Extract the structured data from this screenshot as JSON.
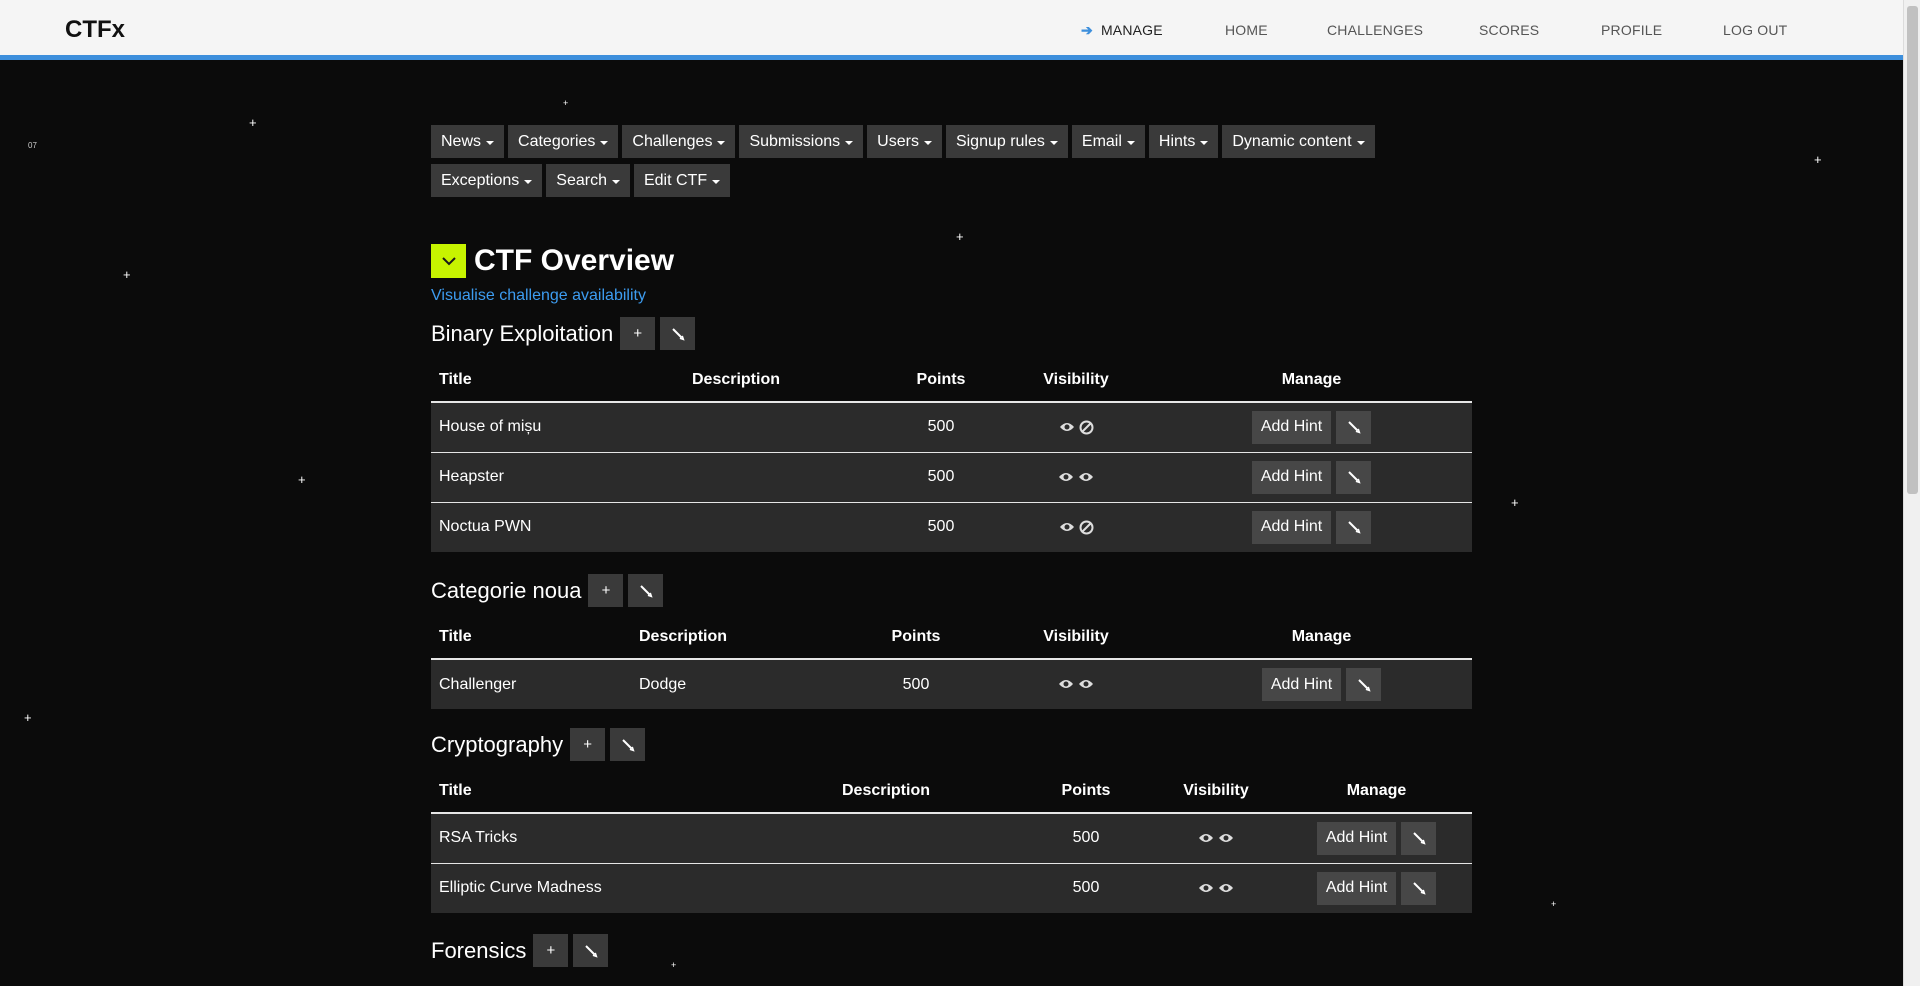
{
  "brand": "CTFx",
  "nav": {
    "manage": "MANAGE",
    "home": "HOME",
    "challenges": "CHALLENGES",
    "scores": "SCORES",
    "profile": "PROFILE",
    "logout": "LOG OUT"
  },
  "menu": {
    "row1": [
      "News",
      "Categories",
      "Challenges",
      "Submissions",
      "Users",
      "Signup rules",
      "Email",
      "Hints",
      "Dynamic content"
    ],
    "row2": [
      "Exceptions",
      "Search",
      "Edit CTF"
    ]
  },
  "star_label": "07",
  "overview": {
    "title": "CTF Overview",
    "visualise_link": "Visualise challenge availability"
  },
  "columns": {
    "title": "Title",
    "description": "Description",
    "points": "Points",
    "visibility": "Visibility",
    "manage": "Manage"
  },
  "add_hint_label": "Add Hint",
  "add_symbol": "+",
  "categories": [
    {
      "name": "Binary Exploitation",
      "challenges": [
        {
          "title": "House of mișu",
          "description": "",
          "points": "500",
          "visibility": [
            "eye-icon",
            "banned-icon"
          ]
        },
        {
          "title": "Heapster",
          "description": "",
          "points": "500",
          "visibility": [
            "eye-icon",
            "eye-icon"
          ]
        },
        {
          "title": "Noctua PWN",
          "description": "",
          "points": "500",
          "visibility": [
            "eye-icon",
            "banned-icon"
          ]
        }
      ]
    },
    {
      "name": "Categorie noua",
      "challenges": [
        {
          "title": "Challenger",
          "description": "Dodge",
          "points": "500",
          "visibility": [
            "eye-icon",
            "eye-icon"
          ]
        }
      ]
    },
    {
      "name": "Cryptography",
      "challenges": [
        {
          "title": "RSA Tricks",
          "description": "",
          "points": "500",
          "visibility": [
            "eye-icon",
            "eye-icon"
          ]
        },
        {
          "title": "Elliptic Curve Madness",
          "description": "",
          "points": "500",
          "visibility": [
            "eye-icon",
            "eye-icon"
          ]
        }
      ]
    },
    {
      "name": "Forensics",
      "challenges": []
    }
  ],
  "colors": {
    "accent": "#3d8fdc",
    "toggle": "#c7f400",
    "link": "#3d9cf0",
    "background": "#0b0b0b"
  }
}
